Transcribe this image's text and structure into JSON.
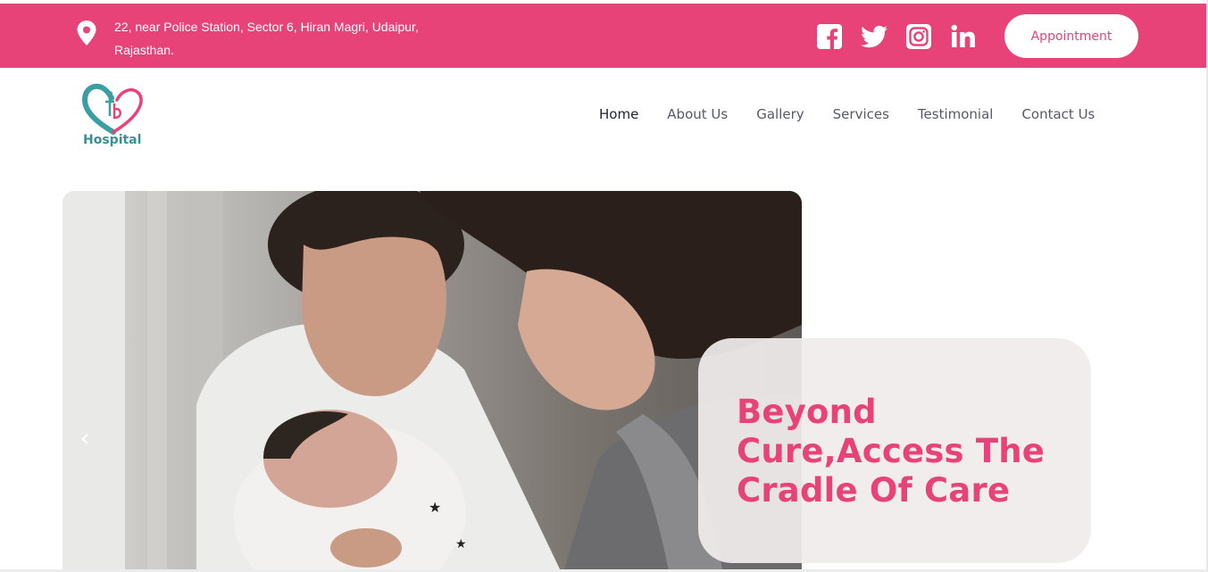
{
  "topbar": {
    "address_line1": "22, near Police Station, Sector 6, Hiran Magri, Udaipur,",
    "address_line2": "Rajasthan.",
    "appointment_label": "Appointment",
    "socials": [
      "facebook-icon",
      "twitter-icon",
      "instagram-icon",
      "linkedin-icon"
    ],
    "color": "#e84379"
  },
  "logo": {
    "text": "Hospital"
  },
  "nav": {
    "items": [
      {
        "label": "Home",
        "active": true
      },
      {
        "label": "About Us"
      },
      {
        "label": "Gallery"
      },
      {
        "label": "Services"
      },
      {
        "label": "Testimonial"
      },
      {
        "label": "Contact Us"
      }
    ]
  },
  "hero": {
    "caption": "Beyond Cure,Access The Cradle Of Care",
    "prev_arrow": "‹",
    "image_description_icon": "family-with-newborn-photo"
  }
}
